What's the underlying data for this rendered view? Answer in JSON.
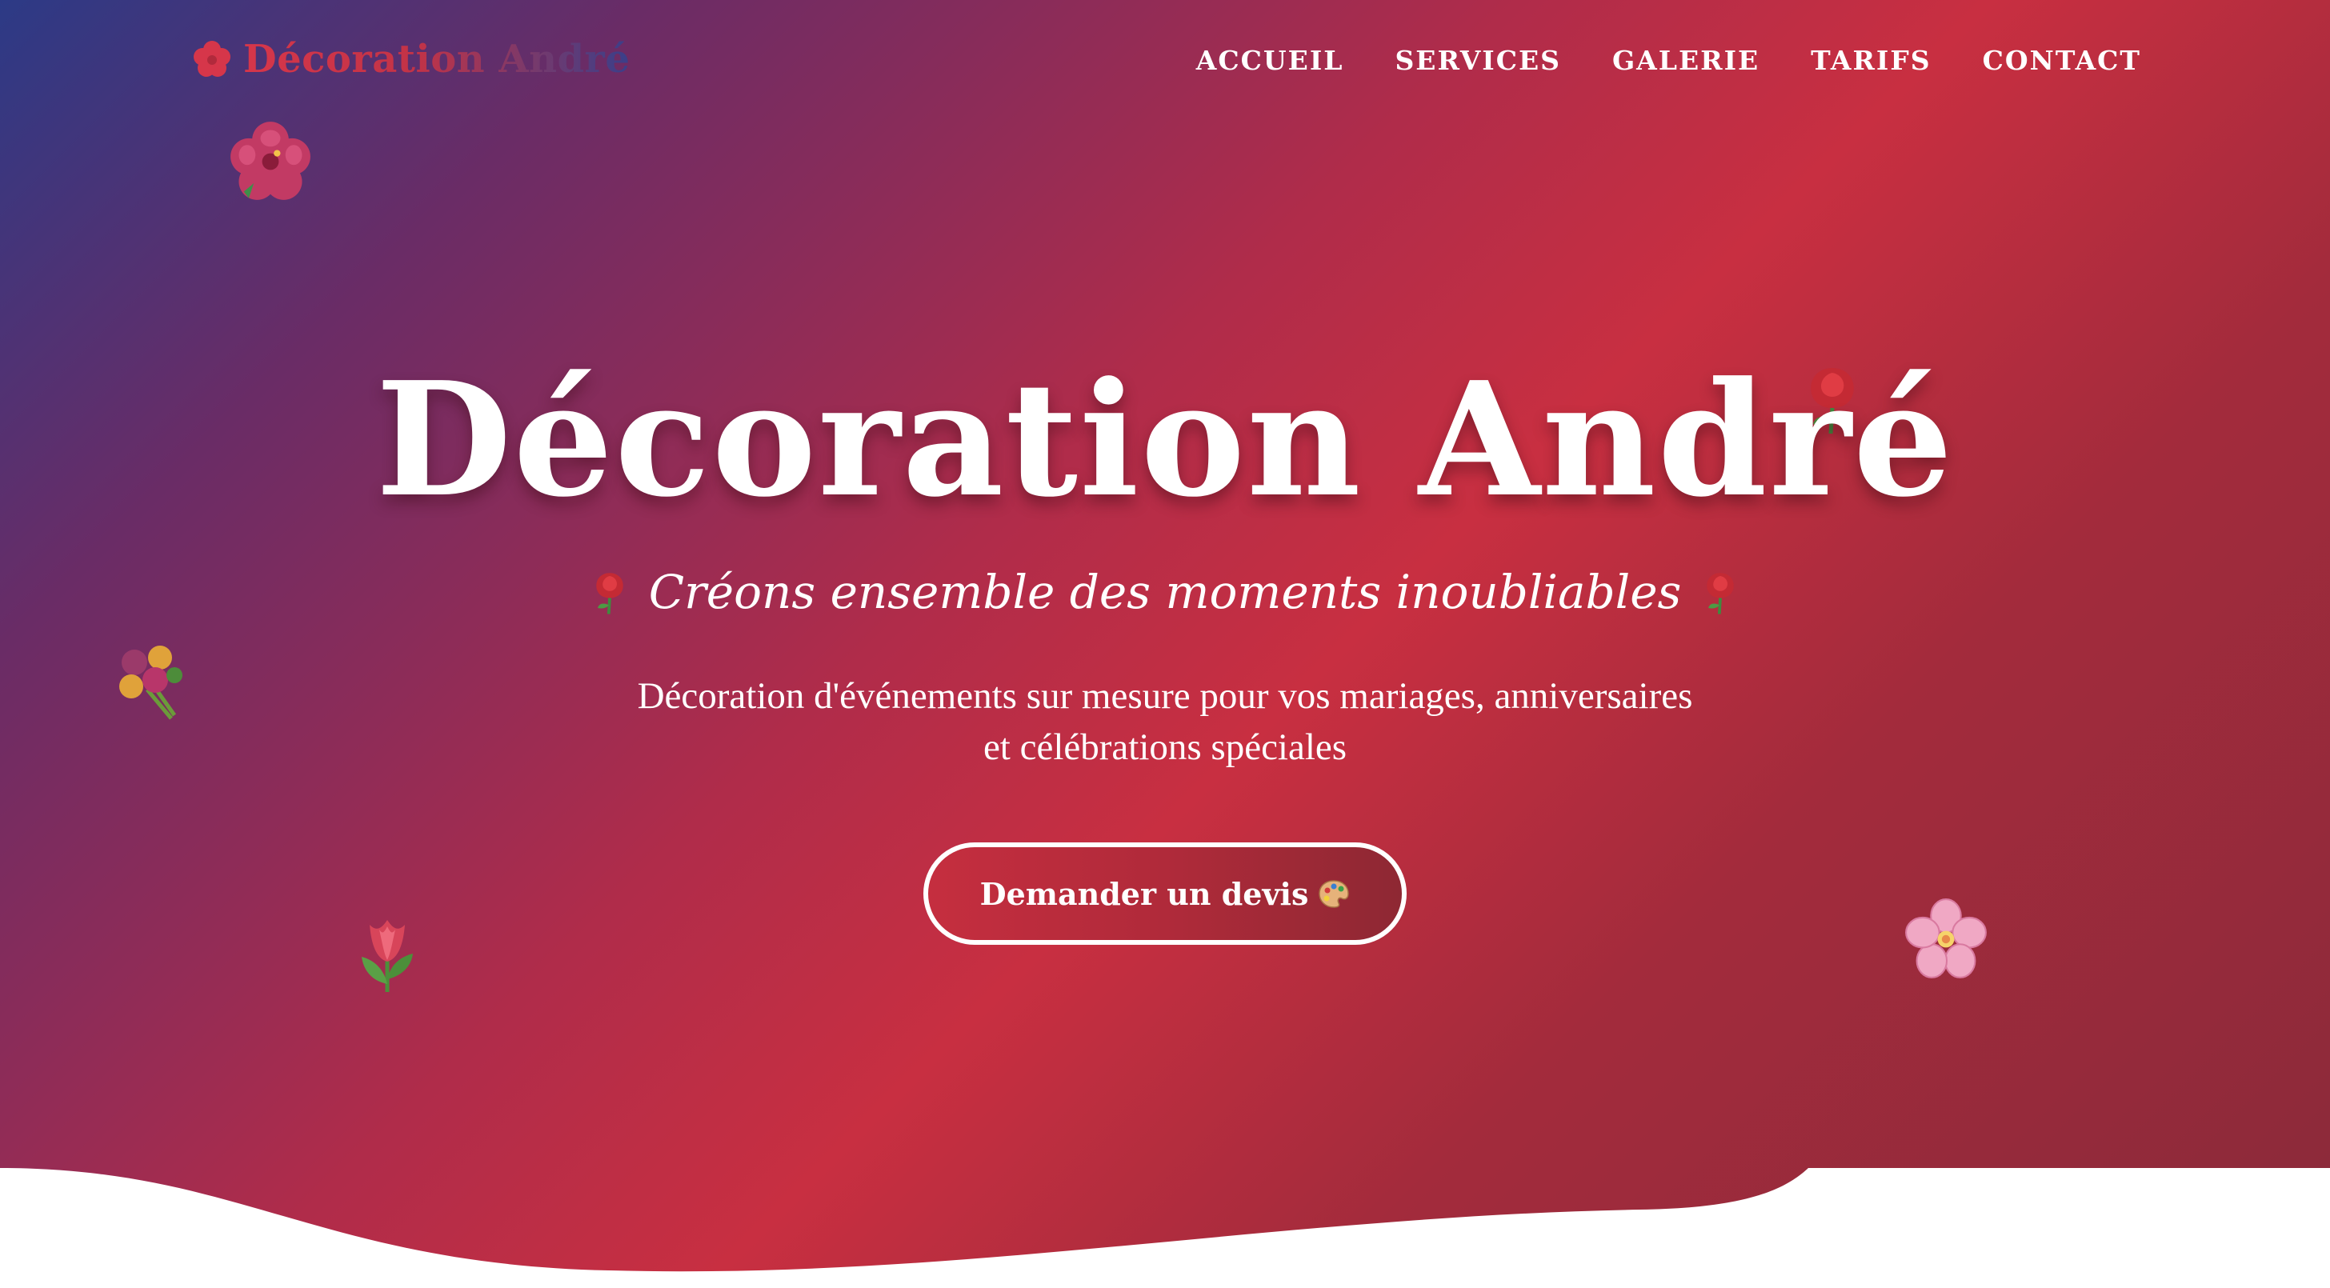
{
  "brand": {
    "name": "Décoration André",
    "logo_icon": "flower-icon"
  },
  "nav": {
    "items": [
      {
        "label": "ACCUEIL"
      },
      {
        "label": "SERVICES"
      },
      {
        "label": "GALERIE"
      },
      {
        "label": "TARIFS"
      },
      {
        "label": "CONTACT"
      }
    ]
  },
  "hero": {
    "title": "Décoration André",
    "tagline": "Créons ensemble des moments inoubliables",
    "tagline_icon": "rose-icon",
    "description_line1": "Décoration d'événements sur mesure pour vos mariages, anniversaires",
    "description_line2": "et célébrations spéciales",
    "cta_label": "Demander un devis",
    "cta_icon": "palette-icon"
  },
  "decorations": [
    "hibiscus-icon",
    "rose-icon",
    "bouquet-icon",
    "tulip-icon",
    "cherry-blossom-icon"
  ],
  "colors": {
    "gradient_start": "#2c3a86",
    "gradient_mid": "#c82f41",
    "gradient_end": "#8a2a3a",
    "text": "#ffffff",
    "background": "#ffffff"
  }
}
